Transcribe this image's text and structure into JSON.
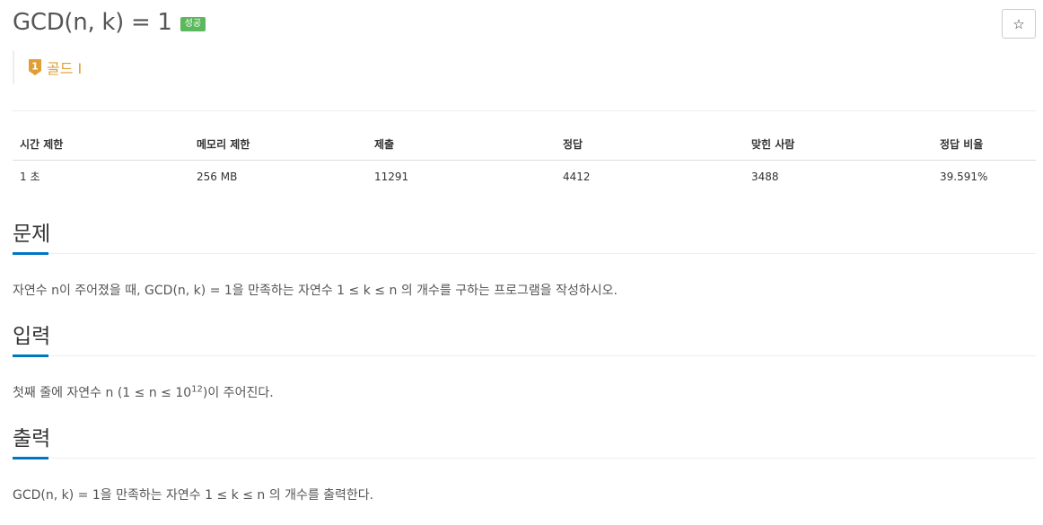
{
  "header": {
    "title": "GCD(n, k) = 1",
    "status_badge": "성공",
    "star_icon": "☆",
    "tier": {
      "label": "골드 I",
      "digit": "1",
      "color": "#e09e37"
    }
  },
  "info_table": {
    "columns": [
      "시간 제한",
      "메모리 제한",
      "제출",
      "정답",
      "맞힌 사람",
      "정답 비율"
    ],
    "row": [
      "1 초",
      "256 MB",
      "11291",
      "4412",
      "3488",
      "39.591%"
    ]
  },
  "sections": {
    "problem": {
      "title": "문제",
      "text": "자연수 n이 주어졌을 때, GCD(n, k) = 1을 만족하는 자연수 1 ≤ k ≤ n 의 개수를 구하는 프로그램을 작성하시오."
    },
    "input": {
      "title": "입력",
      "text_before": "첫째 줄에 자연수 n (1 ≤ n ≤ 10",
      "sup": "12",
      "text_after": ")이 주어진다."
    },
    "output": {
      "title": "출력",
      "text": "GCD(n, k) = 1을 만족하는 자연수 1 ≤ k ≤ n 의 개수를 출력한다."
    }
  },
  "colors": {
    "accent": "#0076c0",
    "success": "#5cb85c",
    "gold": "#e09e37"
  }
}
